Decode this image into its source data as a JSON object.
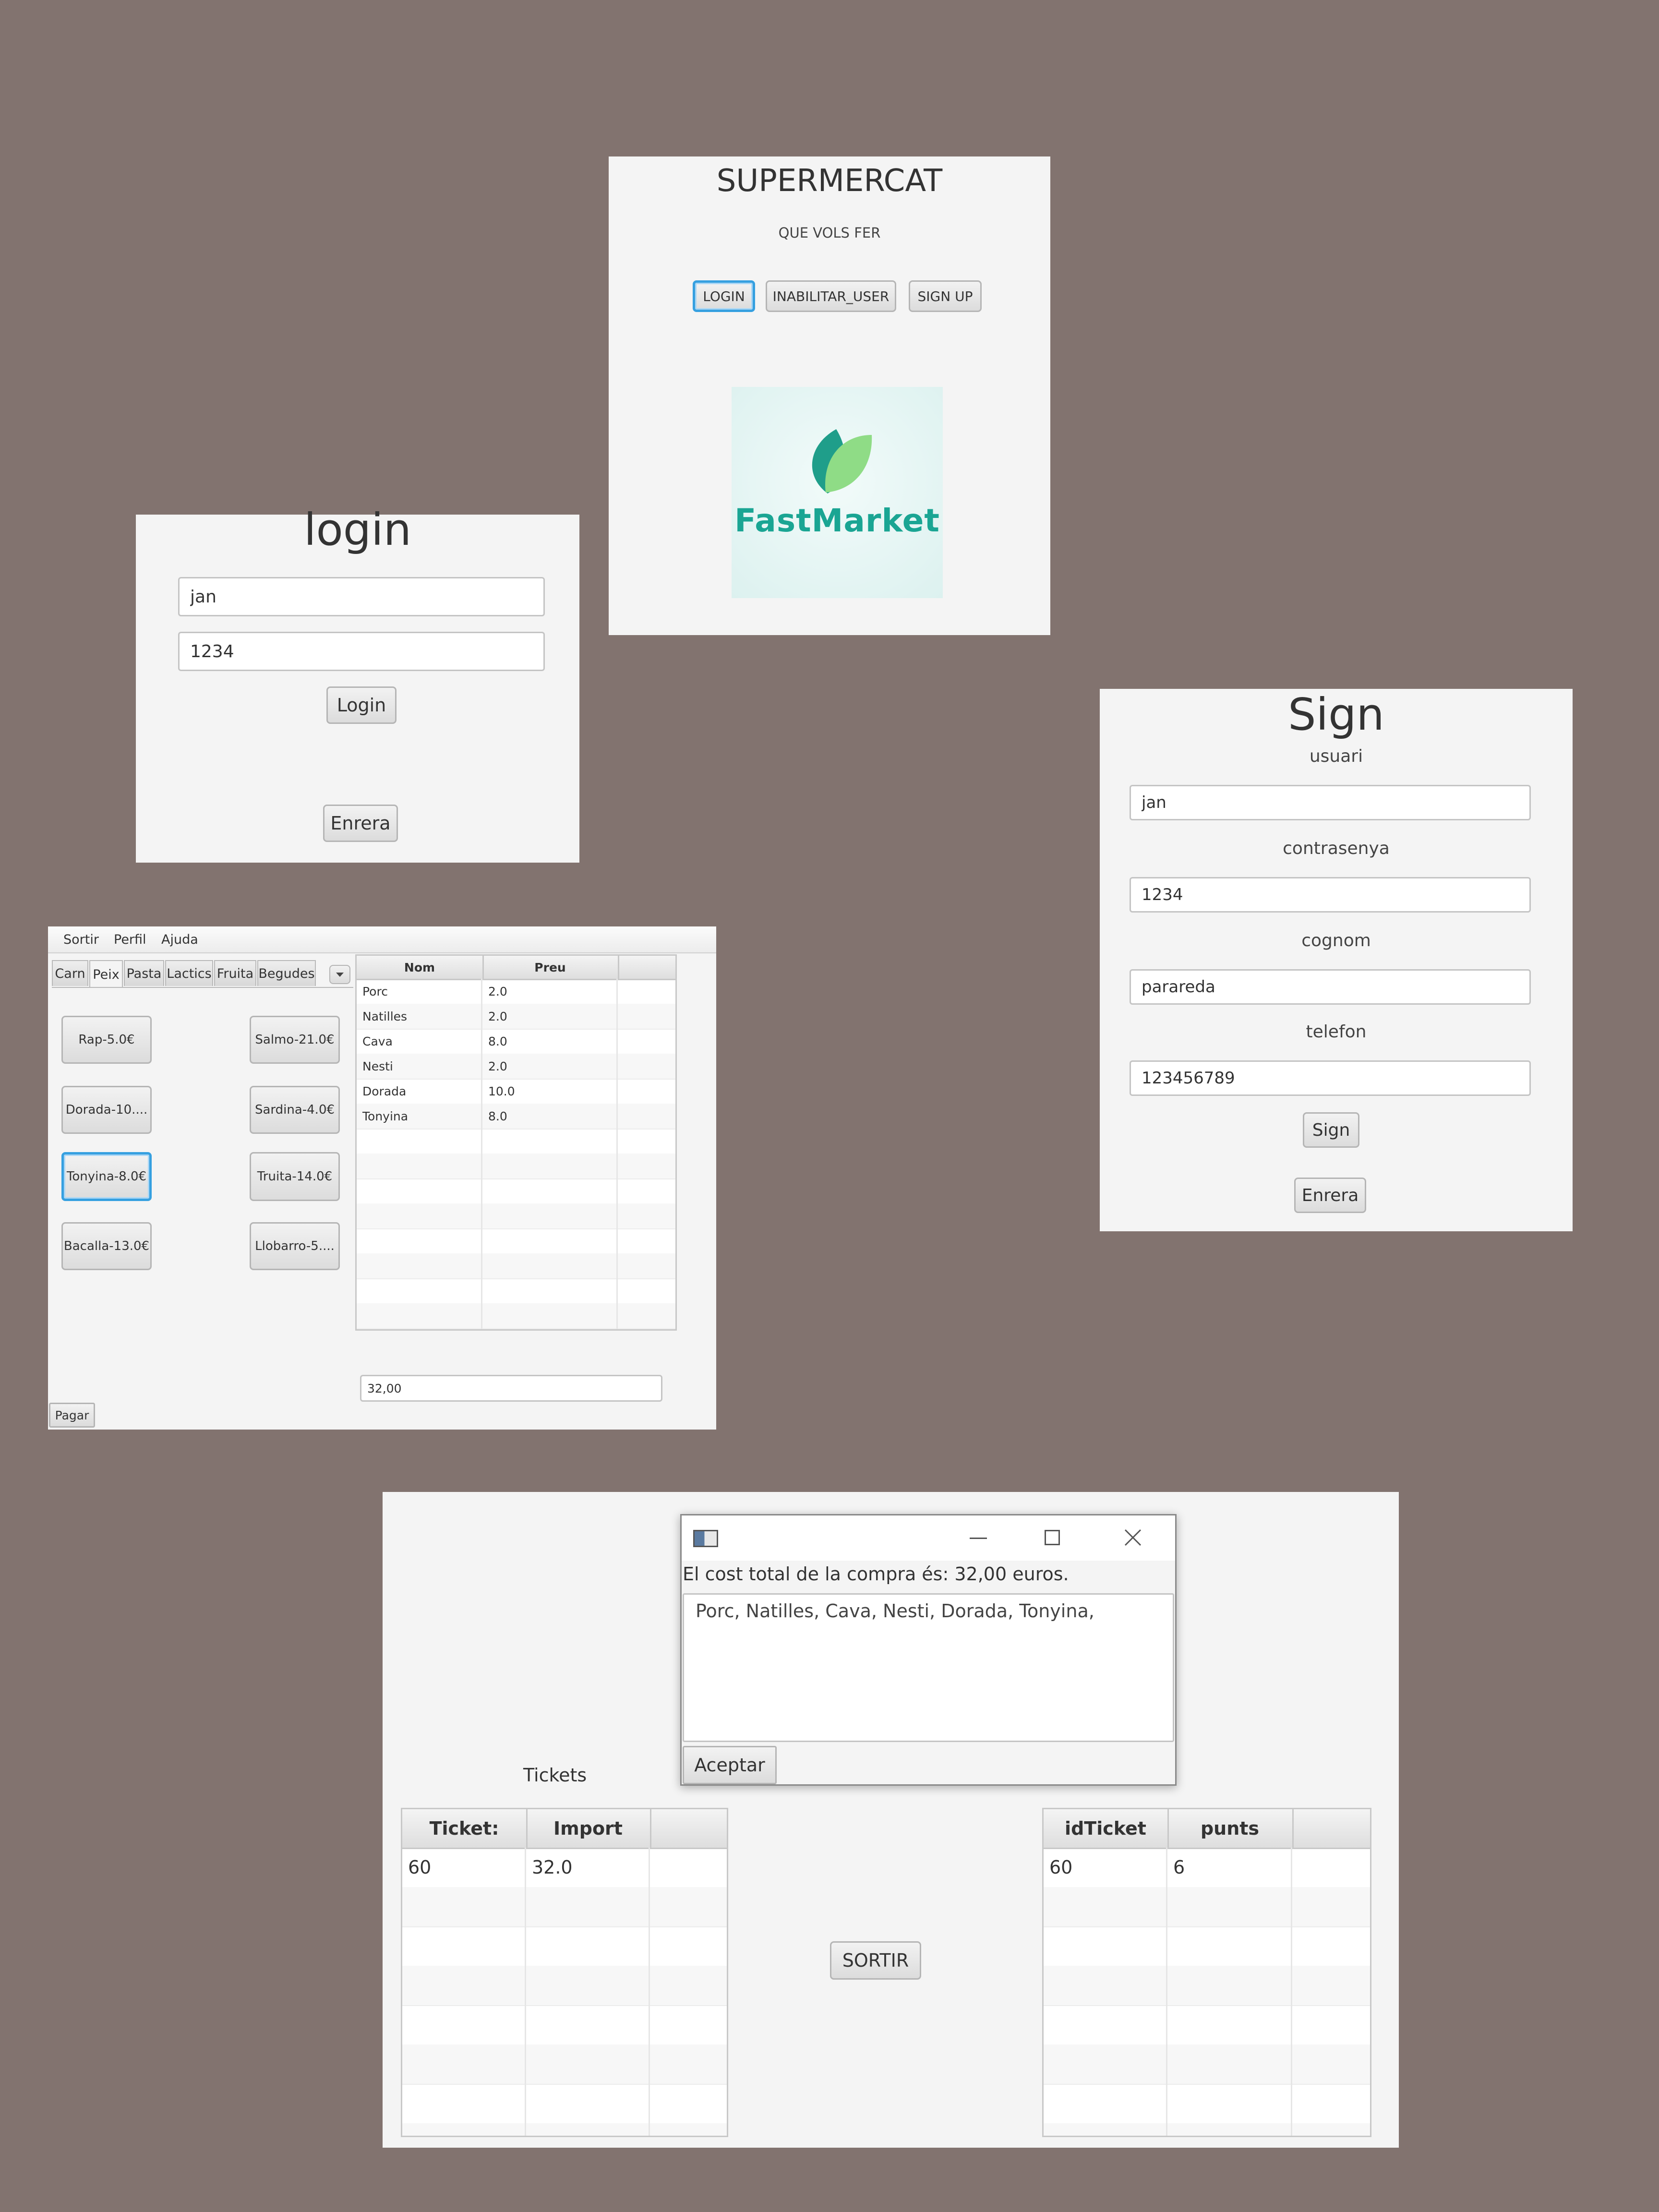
{
  "home": {
    "title": "SUPERMERCAT",
    "subtitle": "QUE VOLS FER",
    "buttons": {
      "login": "LOGIN",
      "disable": "INABILITAR_USER",
      "signup": "SIGN UP"
    },
    "logo_text": "FastMarket",
    "logo_colors": {
      "text": "#1aa593",
      "leaf_dark": "#1f9e8a",
      "leaf_light": "#8fdc86",
      "bg": "#e3f4f3"
    }
  },
  "login": {
    "title": "login",
    "user_value": "jan",
    "pass_value": "1234",
    "login_button": "Login",
    "back_button": "Enrera"
  },
  "sign": {
    "title": "Sign",
    "label_user": "usuari",
    "value_user": "jan",
    "label_pass": "contrasenya",
    "value_pass": "1234",
    "label_surname": "cognom",
    "value_surname": "parareda",
    "label_phone": "telefon",
    "value_phone": "123456789",
    "sign_button": "Sign",
    "back_button": "Enrera"
  },
  "shop": {
    "menu": [
      "Sortir",
      "Perfil",
      "Ajuda"
    ],
    "tabs": [
      "Carn",
      "Peix",
      "Pasta",
      "Lactics",
      "Fruita",
      "Begudes"
    ],
    "selected_tab": "Peix",
    "products": [
      "Rap-5.0€",
      "Salmo-21.0€",
      "Dorada-10....",
      "Sardina-4.0€",
      "Tonyina-8.0€",
      "Truita-14.0€",
      "Bacalla-13.0€",
      "Llobarro-5...."
    ],
    "table_headers": [
      "Nom",
      "Preu"
    ],
    "rows": [
      [
        "Porc",
        "2.0"
      ],
      [
        "Natilles",
        "2.0"
      ],
      [
        "Cava",
        "8.0"
      ],
      [
        "Nesti",
        "2.0"
      ],
      [
        "Dorada",
        "10.0"
      ],
      [
        "Tonyina",
        "8.0"
      ]
    ],
    "total_value": "32,00",
    "pay_button": "Pagar"
  },
  "tickets": {
    "dialog_message": "El cost total de la compra és: 32,00 euros.",
    "dialog_text": "Porc, Natilles, Cava, Nesti, Dorada, Tonyina,",
    "accept_button": "Aceptar",
    "label": "Tickets",
    "left_headers": [
      "Ticket:",
      "Import"
    ],
    "left_rows": [
      [
        "60",
        "32.0"
      ]
    ],
    "right_headers": [
      "idTicket",
      "punts"
    ],
    "right_rows": [
      [
        "60",
        "6"
      ]
    ],
    "exit_button": "SORTIR"
  }
}
